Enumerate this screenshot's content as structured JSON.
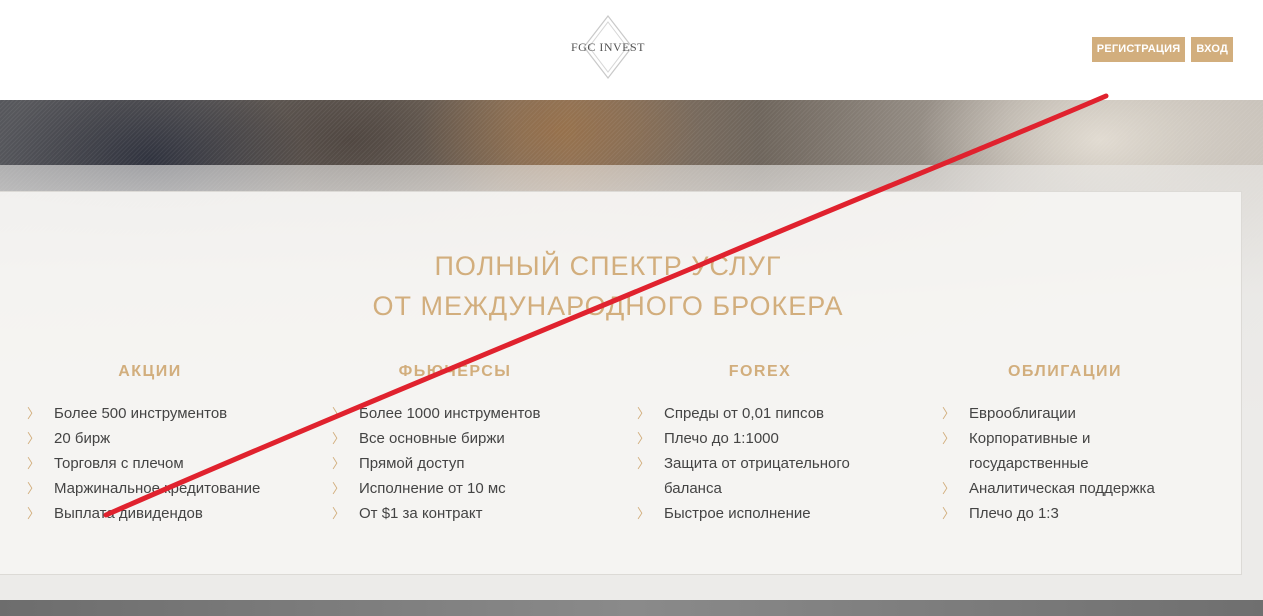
{
  "header": {
    "logo_text": "FGC INVEST",
    "register_label": "РЕГИСТРАЦИЯ",
    "login_label": "ВХОД"
  },
  "main": {
    "heading_line1": "ПОЛНЫЙ СПЕКТР УСЛУГ",
    "heading_line2": "ОТ МЕЖДУНАРОДНОГО БРОКЕРА",
    "columns": [
      {
        "title": "АКЦИИ",
        "items": [
          "Более 500 инструментов",
          "20 бирж",
          "Торговля с плечом",
          "Маржинальное кредитование",
          "Выплата дивидендов"
        ]
      },
      {
        "title": "ФЬЮЧЕРСЫ",
        "items": [
          "Более 1000 инструментов",
          "Все основные биржи",
          "Прямой доступ",
          "Исполнение от 10 мс",
          "От $1 за контракт"
        ]
      },
      {
        "title": "FOREX",
        "items": [
          "Спреды от 0,01 пипсов",
          "Плечо до 1:1000",
          "Защита от отрицательного баланса",
          "Быстрое исполнение"
        ]
      },
      {
        "title": "ОБЛИГАЦИИ",
        "items": [
          "Еврооблигации",
          "Корпоративные и государственные",
          "Аналитическая поддержка",
          "Плечо до 1:3"
        ]
      }
    ]
  },
  "colors": {
    "accent": "#d2ae7d",
    "text": "#444444",
    "annotation_red": "#e0222e"
  },
  "icons": {
    "bullet": "chevron-right-icon",
    "logo": "diamond-logo-icon"
  }
}
